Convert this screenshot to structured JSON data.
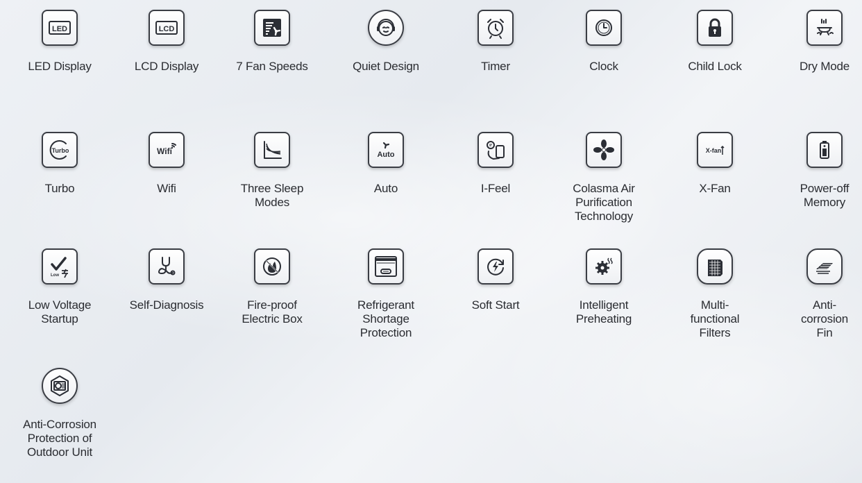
{
  "features": [
    {
      "label": "LED Display",
      "icon": "led-display-icon",
      "icon_text": "LED"
    },
    {
      "label": "LCD Display",
      "icon": "lcd-display-icon",
      "icon_text": "LCD"
    },
    {
      "label": "7 Fan Speeds",
      "icon": "fan-speeds-icon"
    },
    {
      "label": "Quiet Design",
      "icon": "quiet-design-icon"
    },
    {
      "label": "Timer",
      "icon": "alarm-clock-icon"
    },
    {
      "label": "Clock",
      "icon": "clock-icon"
    },
    {
      "label": "Child Lock",
      "icon": "padlock-icon"
    },
    {
      "label": "Dry Mode",
      "icon": "dry-mode-icon"
    },
    {
      "label": "Turbo",
      "icon": "turbo-icon",
      "icon_text": "Turbo"
    },
    {
      "label": "Wifi",
      "icon": "wifi-icon",
      "icon_text": "Wifi"
    },
    {
      "label": "Three Sleep\nModes",
      "icon": "sleep-curve-icon"
    },
    {
      "label": "Auto",
      "icon": "auto-icon",
      "icon_text": "Auto"
    },
    {
      "label": "I-Feel",
      "icon": "i-feel-icon"
    },
    {
      "label": "Colasma Air\nPurification\nTechnology",
      "icon": "purification-fan-icon"
    },
    {
      "label": "X-Fan",
      "icon": "x-fan-icon",
      "icon_text": "X-fan"
    },
    {
      "label": "Power-off\nMemory",
      "icon": "battery-memory-icon"
    },
    {
      "label": "Low Voltage\nStartup",
      "icon": "low-voltage-icon",
      "icon_text": "Low"
    },
    {
      "label": "Self-Diagnosis",
      "icon": "stethoscope-icon"
    },
    {
      "label": "Fire-proof\nElectric Box",
      "icon": "fire-proof-icon"
    },
    {
      "label": "Refrigerant\nShortage\nProtection",
      "icon": "refrigerant-unit-icon"
    },
    {
      "label": "Soft Start",
      "icon": "soft-start-icon"
    },
    {
      "label": "Intelligent\nPreheating",
      "icon": "preheating-gear-icon"
    },
    {
      "label": "Multi-\nfunctional\nFilters",
      "icon": "filter-mesh-icon"
    },
    {
      "label": "Anti-\ncorrosion\nFin",
      "icon": "corrosion-fin-icon"
    },
    {
      "label": "Anti-Corrosion\nProtection of\nOutdoor Unit",
      "icon": "outdoor-unit-icon"
    }
  ]
}
